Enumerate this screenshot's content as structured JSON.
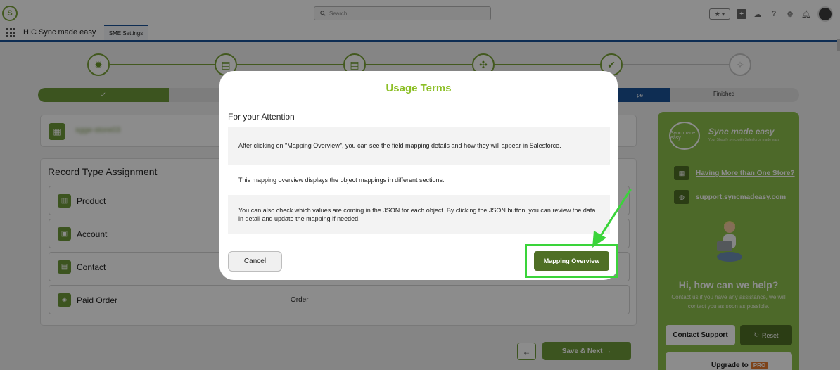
{
  "header": {
    "search_placeholder": "Search...",
    "app_name": "HIC Sync made easy",
    "app_tab": "SME Settings"
  },
  "progress": {
    "done_check": "✓",
    "active_label": "pe",
    "finished_label": "Finished"
  },
  "record_types": {
    "title": "Record Type Assignment",
    "store_name": "sgge-store03",
    "rows": [
      {
        "label": "Product",
        "value": ""
      },
      {
        "label": "Account",
        "value": ""
      },
      {
        "label": "Contact",
        "value": ""
      },
      {
        "label": "Paid Order",
        "value": "Order"
      }
    ]
  },
  "footer": {
    "save_next_label": "Save & Next →"
  },
  "side_panel": {
    "brand": "Sync made easy",
    "tagline": "Your Shopify sync with Salesforce made easy",
    "logo_text": "Sync made easy",
    "link_store": "Having More than One Store?",
    "link_support": "support.syncmadeasy.com",
    "help_title": "Hi, how can we help?",
    "help_text": "Contact us if you have any assistance, we will contact you as soon as possible.",
    "contact_support_label": "Contact Support",
    "reset_label": "Reset",
    "upgrade_label": "Upgrade to",
    "pro_label": "PRO"
  },
  "modal": {
    "title": "Usage Terms",
    "subtitle": "For your Attention",
    "paragraphs": [
      "After clicking on \"Mapping Overview\", you can see the field mapping details and how they will appear in Salesforce.",
      "This mapping overview displays the object mappings in different sections.",
      "You can also check which values are coming in the JSON for each object. By clicking the JSON button, you can review the data in detail and update the mapping if needed."
    ],
    "cancel_label": "Cancel",
    "mapping_overview_label": "Mapping Overview"
  },
  "colors": {
    "brand_green": "#6e9a39",
    "title_green": "#8cbf26",
    "highlight_green": "#3ad43a",
    "nav_blue": "#1b5297"
  }
}
